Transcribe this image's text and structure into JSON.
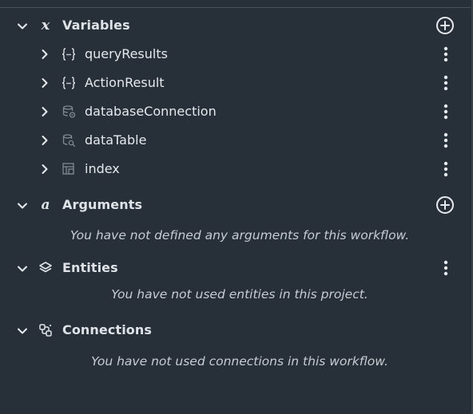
{
  "sections": {
    "variables": {
      "title": "Variables",
      "icon": "variable-x-icon",
      "items": [
        {
          "label": "queryResults",
          "icon": "curly-braces-icon"
        },
        {
          "label": "ActionResult",
          "icon": "curly-braces-icon"
        },
        {
          "label": "databaseConnection",
          "icon": "database-connection-icon"
        },
        {
          "label": "dataTable",
          "icon": "data-table-search-icon"
        },
        {
          "label": "index",
          "icon": "table-index-icon"
        }
      ]
    },
    "arguments": {
      "title": "Arguments",
      "icon": "argument-a-icon",
      "empty_message": "You have not defined any arguments for this workflow."
    },
    "entities": {
      "title": "Entities",
      "icon": "layers-icon",
      "empty_message": "You have not used entities in this project."
    },
    "connections": {
      "title": "Connections",
      "icon": "connections-icon",
      "empty_message": "You have not used connections in this workflow."
    }
  },
  "colors": {
    "background": "#273039",
    "text": "#e6e9ed",
    "muted_text": "#c6ccd3",
    "icon_muted": "#7f8892"
  }
}
